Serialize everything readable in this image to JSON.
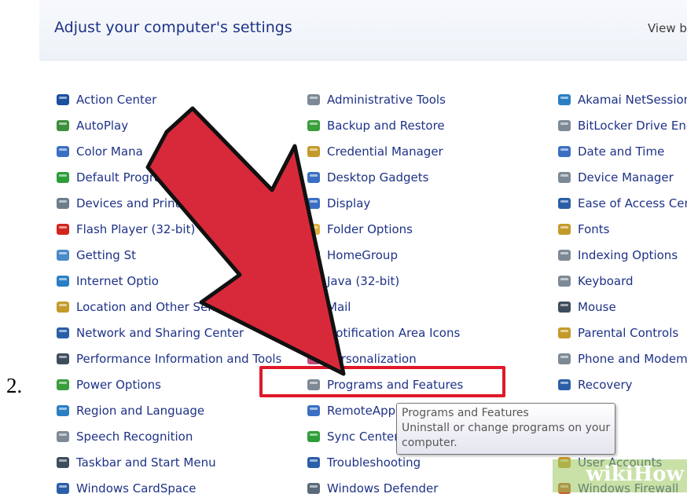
{
  "step_number": "2.",
  "header": {
    "title": "Adjust your computer's settings",
    "view_by": "View b"
  },
  "columns": [
    {
      "items": [
        {
          "label": "Action Center",
          "icon": "flag-icon",
          "color": "#1b4fa0"
        },
        {
          "label": "AutoPlay",
          "icon": "autoplay-icon",
          "color": "#3d8f3d"
        },
        {
          "label": "Color Mana",
          "icon": "color-management-icon",
          "color": "#3a6fc4"
        },
        {
          "label": "Default Progra",
          "icon": "default-programs-icon",
          "color": "#2e9e3a"
        },
        {
          "label": "Devices and Printe",
          "icon": "printer-icon",
          "color": "#6d7d8c"
        },
        {
          "label": "Flash Player (32-bit)",
          "icon": "flash-icon",
          "color": "#d2241c"
        },
        {
          "label": "Getting St",
          "icon": "getting-started-icon",
          "color": "#4a8ac9"
        },
        {
          "label": "Internet Optio",
          "icon": "internet-options-icon",
          "color": "#2a7fc4"
        },
        {
          "label": "Location and Other Sen",
          "icon": "location-icon",
          "color": "#c49a2a"
        },
        {
          "label": "Network and Sharing Center",
          "icon": "network-icon",
          "color": "#2a5fa8"
        },
        {
          "label": "Performance Information and Tools",
          "icon": "performance-icon",
          "color": "#3d4d5c"
        },
        {
          "label": "Power Options",
          "icon": "power-icon",
          "color": "#3a9e3a"
        },
        {
          "label": "Region and Language",
          "icon": "region-icon",
          "color": "#2a7fc4"
        },
        {
          "label": "Speech Recognition",
          "icon": "microphone-icon",
          "color": "#7d8a96"
        },
        {
          "label": "Taskbar and Start Menu",
          "icon": "taskbar-icon",
          "color": "#3d4d5c"
        },
        {
          "label": "Windows CardSpace",
          "icon": "cardspace-icon",
          "color": "#2a5fa8"
        }
      ]
    },
    {
      "items": [
        {
          "label": "Administrative Tools",
          "icon": "admin-tools-icon",
          "color": "#7d8a96"
        },
        {
          "label": "Backup and Restore",
          "icon": "backup-icon",
          "color": "#3a9e3a"
        },
        {
          "label": "Credential Manager",
          "icon": "credential-icon",
          "color": "#c49a2a"
        },
        {
          "label": "Desktop Gadgets",
          "icon": "gadgets-icon",
          "color": "#3a6fc4"
        },
        {
          "label": "Display",
          "icon": "display-icon",
          "color": "#3a6fc4"
        },
        {
          "label": "Folder Options",
          "icon": "folder-icon",
          "color": "#e0b040"
        },
        {
          "label": "HomeGroup",
          "icon": "homegroup-icon",
          "color": "#3a9e3a"
        },
        {
          "label": "Java (32-bit)",
          "icon": "java-icon",
          "color": "#c45a2a"
        },
        {
          "label": "Mail",
          "icon": "mail-icon",
          "color": "#3a6fc4"
        },
        {
          "label": "Notification Area Icons",
          "icon": "notification-icon",
          "color": "#7d8a96"
        },
        {
          "label": "Personalization",
          "icon": "personalization-icon",
          "color": "#c44a7a"
        },
        {
          "label": "Programs and Features",
          "icon": "programs-icon",
          "color": "#7d8a96"
        },
        {
          "label": "RemoteApp and De",
          "icon": "remoteapp-icon",
          "color": "#3a6fc4"
        },
        {
          "label": "Sync Center",
          "icon": "sync-icon",
          "color": "#2e9e3a"
        },
        {
          "label": "Troubleshooting",
          "icon": "troubleshooting-icon",
          "color": "#2a5fa8"
        },
        {
          "label": "Windows Defender",
          "icon": "defender-icon",
          "color": "#5a6a7a"
        }
      ]
    },
    {
      "items": [
        {
          "label": "Akamai NetSession",
          "icon": "akamai-icon",
          "color": "#2a7fc4"
        },
        {
          "label": "BitLocker Drive Encr",
          "icon": "bitlocker-icon",
          "color": "#7d8a96"
        },
        {
          "label": "Date and Time",
          "icon": "clock-icon",
          "color": "#3a6fc4"
        },
        {
          "label": "Device Manager",
          "icon": "device-manager-icon",
          "color": "#7d8a96"
        },
        {
          "label": "Ease of Access Cent",
          "icon": "ease-of-access-icon",
          "color": "#2a5fa8"
        },
        {
          "label": "Fonts",
          "icon": "fonts-icon",
          "color": "#c49a2a"
        },
        {
          "label": "Indexing Options",
          "icon": "indexing-icon",
          "color": "#7d8a96"
        },
        {
          "label": "Keyboard",
          "icon": "keyboard-icon",
          "color": "#7d8a96"
        },
        {
          "label": "Mouse",
          "icon": "mouse-icon",
          "color": "#3d4d5c"
        },
        {
          "label": "Parental Controls",
          "icon": "parental-icon",
          "color": "#c49a2a"
        },
        {
          "label": "Phone and Modem",
          "icon": "phone-icon",
          "color": "#7d8a96"
        },
        {
          "label": "Recovery",
          "icon": "recovery-icon",
          "color": "#2a5fa8"
        },
        {
          "label": "",
          "icon": "",
          "color": "#ffffff"
        },
        {
          "label": "",
          "icon": "",
          "color": "#ffffff"
        },
        {
          "label": "User Accounts",
          "icon": "user-accounts-icon",
          "color": "#c49a2a"
        },
        {
          "label": "Windows Firewall",
          "icon": "firewall-icon",
          "color": "#c45a2a"
        }
      ]
    }
  ],
  "tooltip": {
    "title": "Programs and Features",
    "line1": "Uninstall or change programs on your",
    "line2": "computer."
  },
  "annotation": {
    "arrow_color": "#d8293a",
    "highlight_color": "#e0182a"
  },
  "watermark": {
    "text": "wikiHow"
  }
}
